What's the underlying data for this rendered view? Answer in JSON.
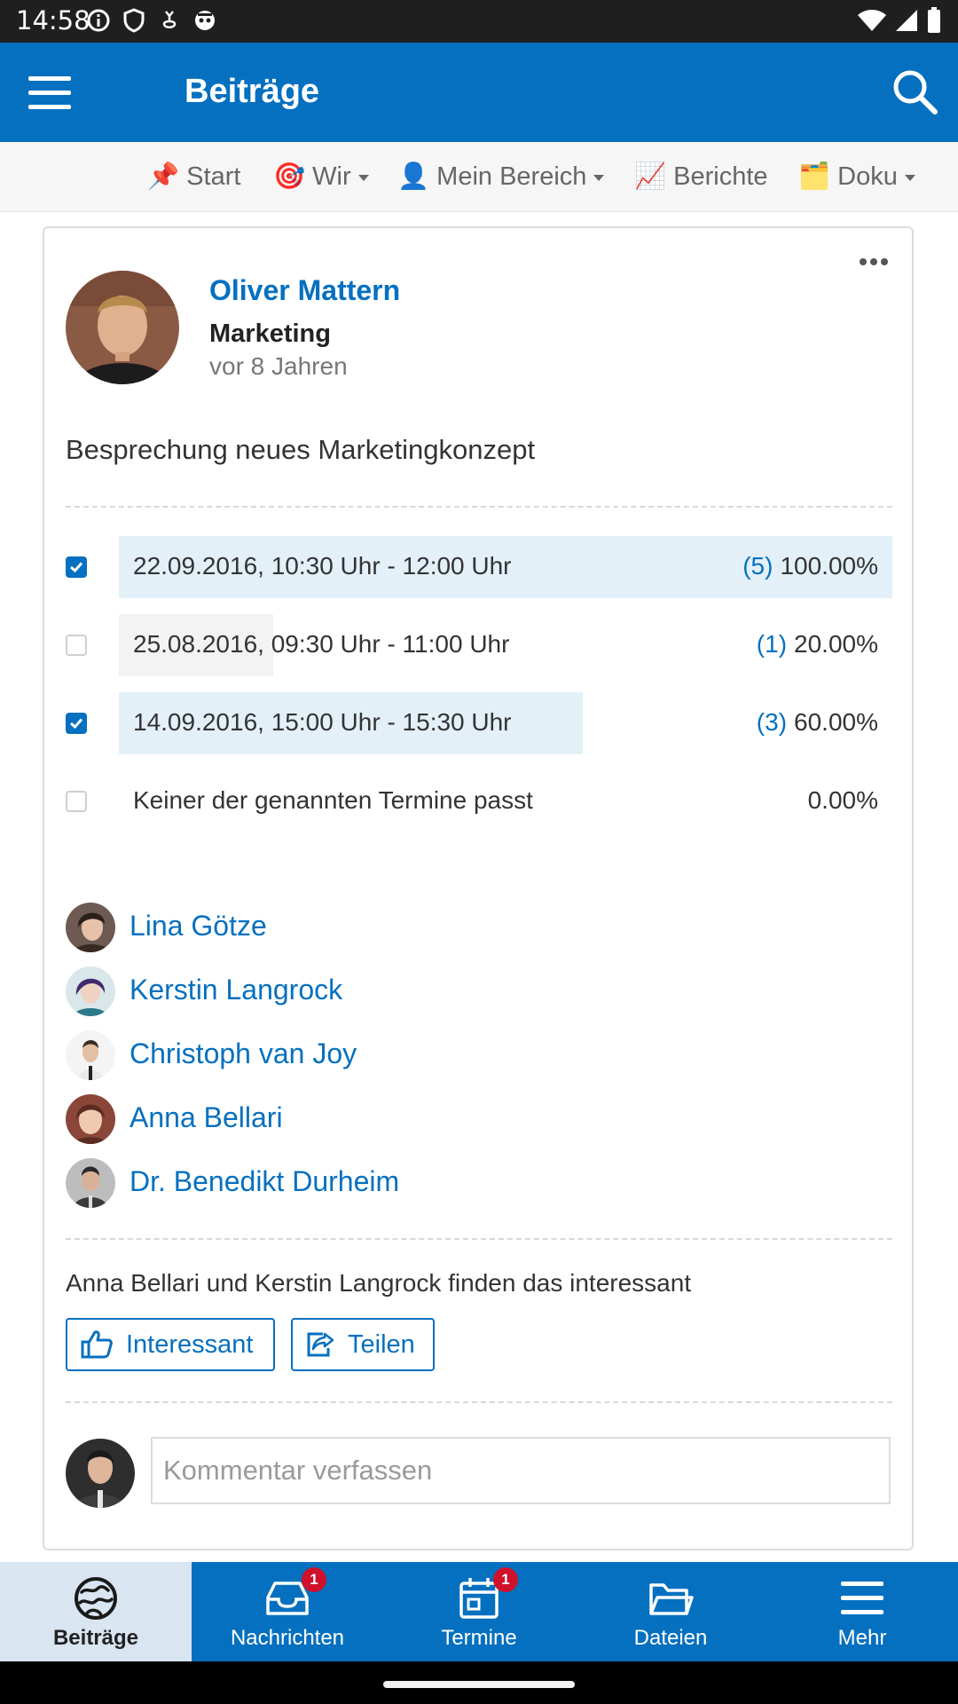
{
  "status_bar": {
    "time": "14:58"
  },
  "app_bar": {
    "title": "Beiträge"
  },
  "nav": {
    "items": [
      {
        "emoji": "📌",
        "label": "Start",
        "dropdown": false
      },
      {
        "emoji": "🎯",
        "label": "Wir",
        "dropdown": true
      },
      {
        "emoji": "👤",
        "label": "Mein Bereich",
        "dropdown": true
      },
      {
        "emoji": "📈",
        "label": "Berichte",
        "dropdown": false
      },
      {
        "emoji": "🗂️",
        "label": "Doku",
        "dropdown": true
      }
    ]
  },
  "post": {
    "author": "Oliver Mattern",
    "department": "Marketing",
    "time": "vor 8 Jahren",
    "title": "Besprechung neues Marketingkonzept",
    "poll": [
      {
        "label": "22.09.2016, 10:30 Uhr - 12:00 Uhr",
        "count": "(5)",
        "percent": "100.00%",
        "checked": true,
        "share": 1.0
      },
      {
        "label": "25.08.2016, 09:30 Uhr - 11:00 Uhr",
        "count": "(1)",
        "percent": "20.00%",
        "checked": false,
        "share": 0.2
      },
      {
        "label": "14.09.2016, 15:00 Uhr - 15:30 Uhr",
        "count": "(3)",
        "percent": "60.00%",
        "checked": true,
        "share": 0.6
      },
      {
        "label": "Keiner der genannten Termine passt",
        "count": "",
        "percent": "0.00%",
        "checked": false,
        "share": 0.0
      }
    ],
    "voters": [
      "Lina Götze",
      "Kerstin Langrock",
      "Christoph van Joy",
      "Anna Bellari",
      "Dr. Benedikt Durheim"
    ],
    "likes_text": "Anna Bellari und Kerstin Langrock finden das interessant",
    "like_button": "Interessant",
    "share_button": "Teilen",
    "comment_placeholder": "Kommentar verfassen"
  },
  "tabs": [
    {
      "label": "Beiträge",
      "icon": "beitraege-icon",
      "badge": "",
      "active": true
    },
    {
      "label": "Nachrichten",
      "icon": "inbox-icon",
      "badge": "1",
      "active": false
    },
    {
      "label": "Termine",
      "icon": "calendar-icon",
      "badge": "1",
      "active": false
    },
    {
      "label": "Dateien",
      "icon": "folder-icon",
      "badge": "",
      "active": false
    },
    {
      "label": "Mehr",
      "icon": "menu-icon",
      "badge": "",
      "active": false
    }
  ],
  "colors": {
    "primary": "#0570c0",
    "bar_selected": "#e3f0f8",
    "bar_unselected": "#f3f3f3",
    "badge": "#d0112b"
  }
}
